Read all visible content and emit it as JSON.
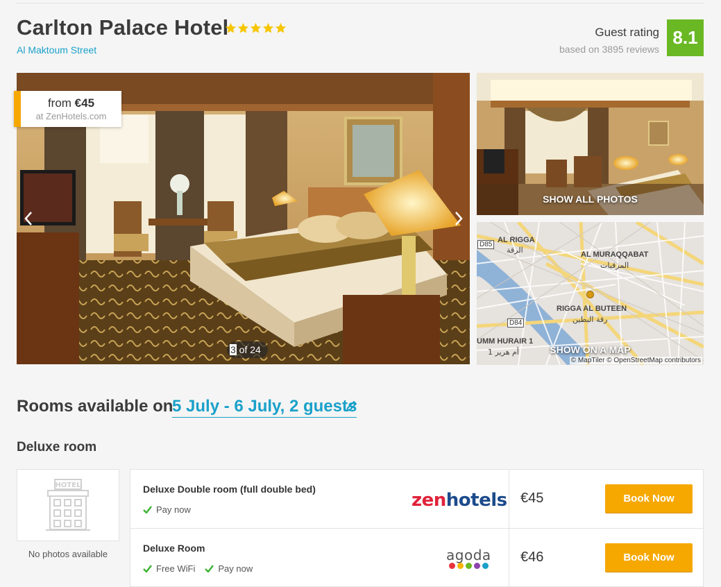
{
  "hotel": {
    "name": "Carlton Palace Hotel",
    "stars": 5,
    "address": "Al Maktoum Street"
  },
  "rating": {
    "label": "Guest rating",
    "reviews": "based on 3895 reviews",
    "score": "8.1"
  },
  "gallery": {
    "price_from_prefix": "from ",
    "price_from_value": "€45",
    "price_site": "at ZenHotels.com",
    "counter_current": "3",
    "counter_rest": " of 24",
    "show_all_photos": "SHOW ALL PHOTOS"
  },
  "map": {
    "show_on_map": "SHOW ON A MAP",
    "attribution": "© MapTiler © OpenStreetMap contributors",
    "labels": {
      "al_rigga": "AL RIGGA",
      "al_rigga_ar": "الرقة",
      "al_muraqqabat": "AL MURAQQABAT",
      "al_muraqqabat_ar": "المرقبات",
      "rigga_al_buteen": "RIGGA AL BUTEEN",
      "rigga_al_buteen_ar": "رقة البطين",
      "umm_hurair": "UMM HURAIR 1",
      "umm_hurair_ar": "أم هرير 1",
      "d85": "D85",
      "d84": "D84"
    }
  },
  "rooms": {
    "heading": "Rooms available on",
    "dates": "5 July - 6 July, 2 guests",
    "room_type": "Deluxe room",
    "no_photos": "No photos available",
    "offers": [
      {
        "name": "Deluxe Double room (full double bed)",
        "features": [
          "Pay now"
        ],
        "provider": "zenhotels",
        "provider_a": "zen",
        "provider_b": "hotels",
        "price": "€45",
        "book": "Book Now"
      },
      {
        "name": "Deluxe Room",
        "features": [
          "Free WiFi",
          "Pay now"
        ],
        "provider": "agoda",
        "price": "€46",
        "book": "Book Now"
      }
    ]
  },
  "colors": {
    "accent": "#1aa1c9",
    "book": "#f6a800",
    "rating": "#6ab824",
    "check": "#3cb232"
  }
}
